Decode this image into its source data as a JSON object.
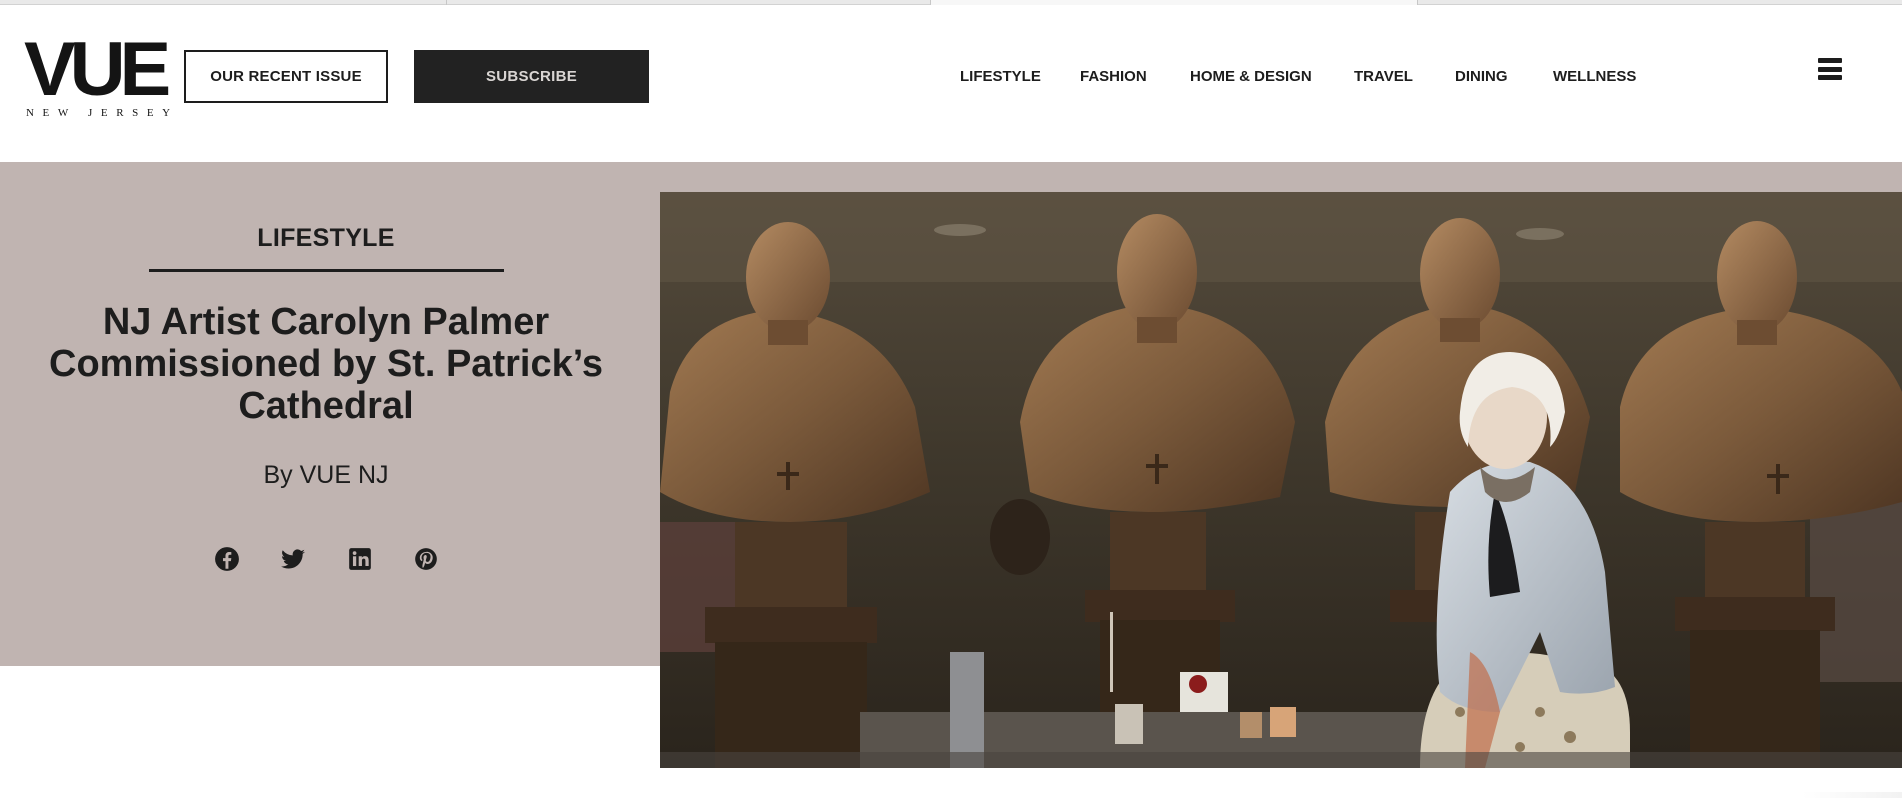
{
  "site": {
    "logo_text": "VUE",
    "logo_subtext": "NEW JERSEY"
  },
  "header": {
    "recent_issue_label": "OUR RECENT ISSUE",
    "subscribe_label": "SUBSCRIBE",
    "nav": [
      "LIFESTYLE",
      "FASHION",
      "HOME & DESIGN",
      "TRAVEL",
      "DINING",
      "WELLNESS"
    ],
    "menu_icon": "hamburger-menu-icon"
  },
  "article": {
    "category": "LIFESTYLE",
    "title": "NJ Artist Carolyn Palmer Commissioned by St. Patrick’s Cathedral",
    "byline": "By VUE NJ",
    "share_icons": [
      "facebook-icon",
      "twitter-icon",
      "linkedin-icon",
      "pinterest-icon"
    ]
  },
  "colors": {
    "hero_background": "#c0b4b1",
    "text": "#1d1d1d",
    "subscribe_background": "#222222"
  }
}
